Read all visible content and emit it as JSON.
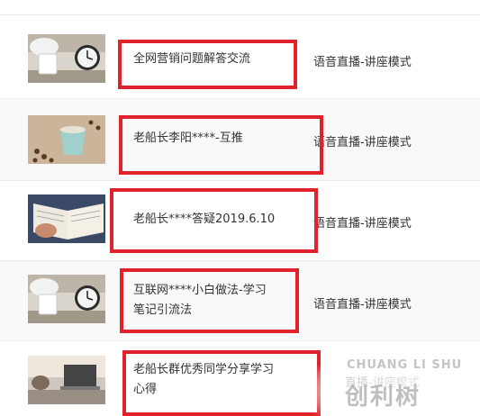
{
  "header": {
    "cols": [
      "",
      "",
      ""
    ]
  },
  "rows": [
    {
      "name": "全网营销问题解答交流",
      "type": "语音直播-讲座模式",
      "thumb": "clock-mug-icon"
    },
    {
      "name": "老船长李阳****-互推",
      "type": "语音直播-讲座模式",
      "thumb": "coffee-cup-icon"
    },
    {
      "name": "老船长****答疑2019.6.10",
      "type": "语音直播-讲座模式",
      "thumb": "open-book-icon"
    },
    {
      "name_lines": [
        "互联网****小白做法-学习",
        "笔记引流法"
      ],
      "type": "语音直播-讲座模式",
      "thumb": "clock-mug-icon"
    },
    {
      "name_lines": [
        "老船长群优秀同学分享学习",
        "心得"
      ],
      "type": "直播-讲座模式",
      "thumb": "laptop-icon"
    }
  ],
  "watermark": {
    "line1": "CHUANG LI SHU",
    "line2": "创利树"
  },
  "colors": {
    "highlight": "#e0222d",
    "alt_row": "#f9f9f9"
  }
}
